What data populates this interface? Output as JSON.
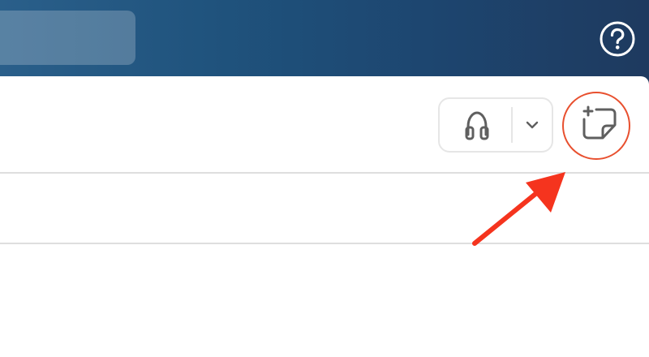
{
  "header": {
    "search": {
      "value": "",
      "placeholder": ""
    },
    "help_icon": "question-circle-icon"
  },
  "toolbar": {
    "headphones_icon": "headphones-icon",
    "chevron_icon": "chevron-down-icon",
    "new_note_icon": "new-sticky-note-icon"
  },
  "annotation": {
    "highlight_target": "new-note-button",
    "color": "#e8502f"
  },
  "colors": {
    "header_gradient_start": "#2a5f8a",
    "header_gradient_end": "#1e3a5f",
    "icon_gray": "#5f5f5f",
    "accent_red": "#e8502f"
  }
}
